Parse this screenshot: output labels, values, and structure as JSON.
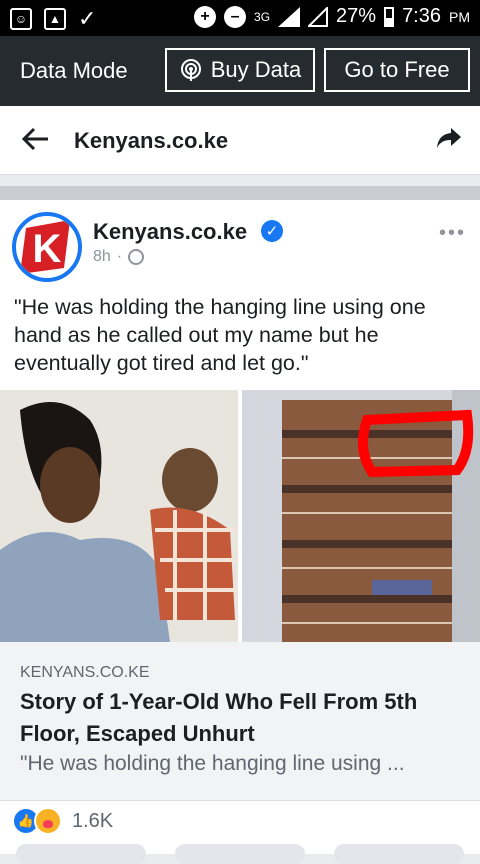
{
  "status_bar": {
    "network": "3G",
    "battery": "27%",
    "time": "7:36",
    "ampm": "PM"
  },
  "data_bar": {
    "mode_label": "Data Mode",
    "buy_label": "Buy Data",
    "free_label": "Go to Free"
  },
  "nav": {
    "title": "Kenyans.co.ke"
  },
  "post": {
    "author": "Kenyans.co.ke",
    "avatar_letter": "K",
    "time": "8h",
    "separator": "·",
    "text": "\"He was holding the hanging line using one hand as he called out my name but he eventually got tired and let go.\"",
    "link": {
      "domain": "KENYANS.CO.KE",
      "title": "Story of 1-Year-Old Who Fell From 5th Floor, Escaped Unhurt",
      "description": "\"He was holding the hanging line using ..."
    },
    "reactions": {
      "count": "1.6K",
      "icons": [
        "like-icon",
        "care-icon"
      ]
    }
  },
  "colors": {
    "facebook_blue": "#1877f2",
    "data_bar_bg": "#262b30",
    "avatar_red": "#d71f26",
    "highlight_red": "#ff0000"
  }
}
